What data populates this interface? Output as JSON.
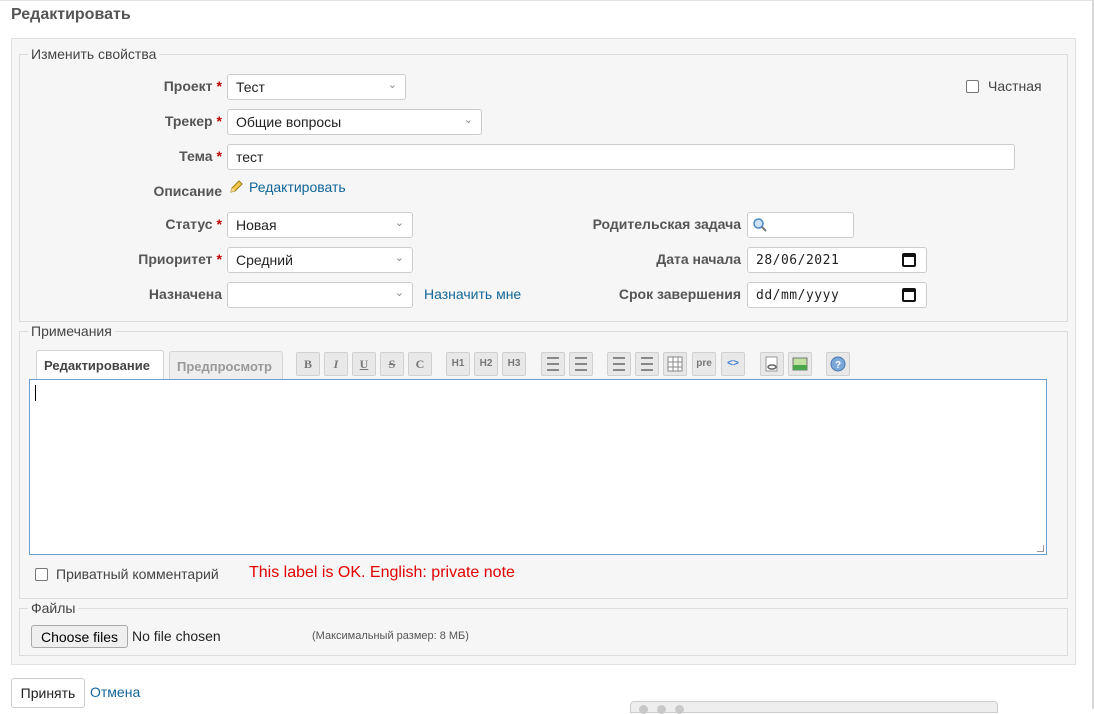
{
  "page_title": "Редактировать",
  "properties": {
    "legend": "Изменить свойства",
    "project": {
      "label": "Проект",
      "value": "Тест"
    },
    "tracker": {
      "label": "Трекер",
      "value": "Общие вопросы"
    },
    "subject": {
      "label": "Тема",
      "value": "тест"
    },
    "description": {
      "label": "Описание",
      "edit_link": "Редактировать"
    },
    "status": {
      "label": "Статус",
      "value": "Новая"
    },
    "priority": {
      "label": "Приоритет",
      "value": "Средний"
    },
    "assignee": {
      "label": "Назначена",
      "value": "",
      "assign_me": "Назначить мне"
    },
    "private": {
      "label": "Частная",
      "checked": false
    },
    "parent_task": {
      "label": "Родительская задача",
      "value": ""
    },
    "start_date": {
      "label": "Дата начала",
      "value": "28/06/2021"
    },
    "due_date": {
      "label": "Срок завершения",
      "value": "dd/mm/yyyy"
    },
    "required_mark": "*"
  },
  "notes": {
    "legend": "Примечания",
    "tabs": [
      "Редактирование",
      "Предпросмотр"
    ],
    "toolbar": {
      "bold": "B",
      "italic": "I",
      "underline": "U",
      "strike": "S",
      "code": "C",
      "h1": "H1",
      "h2": "H2",
      "h3": "H3",
      "pre": "pre",
      "source": "<>"
    },
    "text": "",
    "private_comment": {
      "label": "Приватный комментарий",
      "checked": false
    },
    "annotation": "This label is OK. English: private note"
  },
  "files": {
    "legend": "Файлы",
    "choose_button": "Choose files",
    "status": "No file chosen",
    "max_size": "(Максимальный размер: 8 МБ)"
  },
  "actions": {
    "submit": "Принять",
    "cancel": "Отмена"
  }
}
